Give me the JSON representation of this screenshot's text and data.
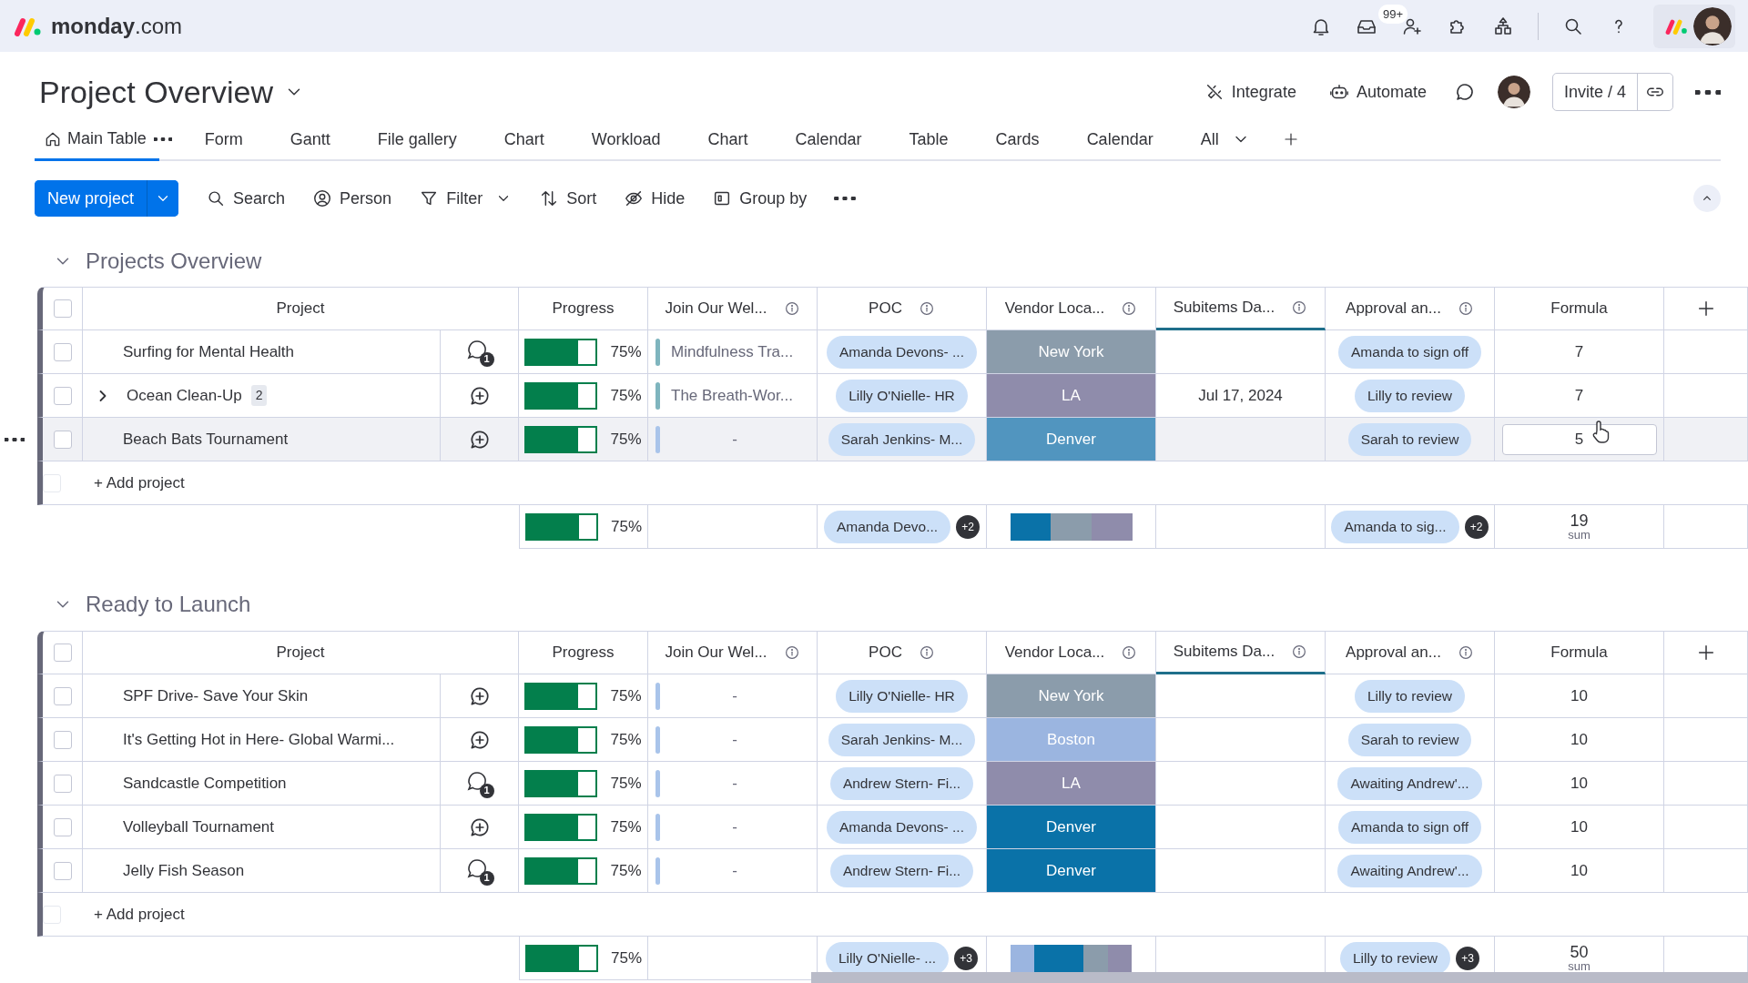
{
  "topbar": {
    "brand": "**monday**.com",
    "inbox_badge": "99+"
  },
  "board": {
    "title": "Project Overview",
    "actions": [
      {
        "label": "Integrate",
        "kind": "integrate"
      },
      {
        "label": "Automate",
        "kind": "automate"
      }
    ],
    "invite": "Invite / 4"
  },
  "views": [
    {
      "label": "Main Table",
      "kind": "main",
      "selected": true
    },
    {
      "label": "Form",
      "kind": "view",
      "selected": false
    },
    {
      "label": "Gantt",
      "kind": "view",
      "selected": false
    },
    {
      "label": "File gallery",
      "kind": "view",
      "selected": false
    },
    {
      "label": "Chart",
      "kind": "view",
      "selected": false
    },
    {
      "label": "Workload",
      "kind": "view",
      "selected": false
    },
    {
      "label": "Chart",
      "kind": "view",
      "selected": false
    },
    {
      "label": "Calendar",
      "kind": "view",
      "selected": false
    },
    {
      "label": "Table",
      "kind": "view",
      "selected": false
    },
    {
      "label": "Cards",
      "kind": "view",
      "selected": false
    },
    {
      "label": "Calendar",
      "kind": "view",
      "selected": false
    }
  ],
  "views_more": "All",
  "toolbar": {
    "primary": "New project",
    "items": [
      {
        "label": "Search",
        "kind": "search"
      },
      {
        "label": "Person",
        "kind": "person"
      },
      {
        "label": "Filter",
        "kind": "filter"
      },
      {
        "label": "Sort",
        "kind": "sort"
      },
      {
        "label": "Hide",
        "kind": "hide"
      },
      {
        "label": "Group by",
        "kind": "group"
      }
    ]
  },
  "groups": [
    {
      "title": "Projects Overview",
      "color": "#676879",
      "header_checked": false,
      "columns": [
        {
          "label": "Project",
          "kind": "name",
          "highlighted": false
        },
        {
          "label": "Progress",
          "kind": "plain",
          "highlighted": false
        },
        {
          "label": "Join Our Wel...",
          "kind": "info",
          "highlighted": false
        },
        {
          "label": "POC",
          "kind": "info",
          "highlighted": false
        },
        {
          "label": "Vendor Loca...",
          "kind": "info",
          "highlighted": false
        },
        {
          "label": "Subitems Da...",
          "kind": "info",
          "highlighted": true
        },
        {
          "label": "Approval an...",
          "kind": "info",
          "highlighted": false
        },
        {
          "label": "Formula",
          "kind": "plain",
          "highlighted": false
        }
      ],
      "rows": [
        {
          "name": "Surfing for Mental Health",
          "checked": false,
          "updates": "1",
          "progress": {
            "level": 0.75,
            "text": "75%"
          },
          "join": {
            "text": "Mindfulness Tra...",
            "color": "#7fb5be"
          },
          "poc": "Amanda Devons- ...",
          "vendor": {
            "text": "New York",
            "color": "#8b9cab"
          },
          "approval": "Amanda to sign off",
          "formula": "7",
          "hovered": false
        },
        {
          "name": "Ocean Clean-Up",
          "checked": false,
          "subitems": {
            "count": "2",
            "expanded": false
          },
          "progress": {
            "level": 0.75,
            "text": "75%"
          },
          "join": {
            "text": "The Breath-Wor...",
            "color": "#7fb5be"
          },
          "poc": "Lilly O'Nielle- HR",
          "vendor": {
            "text": "LA",
            "color": "#8f8cab"
          },
          "date": "Jul 17, 2024",
          "approval": "Lilly to review",
          "formula": "7",
          "hovered": false
        },
        {
          "name": "Beach Bats Tournament",
          "checked": false,
          "progress": {
            "level": 0.75,
            "text": "75%"
          },
          "join": {
            "text": "-",
            "color": "#a9c4ea"
          },
          "poc": "Sarah Jenkins- M...",
          "vendor": {
            "text": "Denver",
            "color": "#5195bf"
          },
          "approval": "Sarah to review",
          "formula": "5",
          "hovered": true
        }
      ],
      "add_row": {
        "label": "+ Add project",
        "checkbox_disabled": true
      },
      "summary": {
        "progress": {
          "level": 0.75,
          "text": "75%"
        },
        "poc": "Amanda Devo...",
        "poc_more": "+2",
        "vendor_segments": [
          {
            "color": "#0a72a8"
          },
          {
            "color": "#8b9cab"
          },
          {
            "color": "#8f8cab"
          }
        ],
        "approval": "Amanda to sig...",
        "approval_more": "+2",
        "formula": "19",
        "formula_label": "sum"
      }
    },
    {
      "title": "Ready to Launch",
      "color": "#676879",
      "header_checked": false,
      "columns": [
        {
          "label": "Project",
          "kind": "name",
          "highlighted": false
        },
        {
          "label": "Progress",
          "kind": "plain",
          "highlighted": false
        },
        {
          "label": "Join Our Wel...",
          "kind": "info",
          "highlighted": false
        },
        {
          "label": "POC",
          "kind": "info",
          "highlighted": false
        },
        {
          "label": "Vendor Loca...",
          "kind": "info",
          "highlighted": false
        },
        {
          "label": "Subitems Da...",
          "kind": "info",
          "highlighted": true
        },
        {
          "label": "Approval an...",
          "kind": "info",
          "highlighted": false
        },
        {
          "label": "Formula",
          "kind": "plain",
          "highlighted": false
        }
      ],
      "rows": [
        {
          "name": "SPF Drive- Save Your Skin",
          "checked": false,
          "progress": {
            "level": 0.75,
            "text": "75%"
          },
          "join": {
            "text": "-",
            "color": "#a9c4ea"
          },
          "poc": "Lilly O'Nielle- HR",
          "vendor": {
            "text": "New York",
            "color": "#8b9cab"
          },
          "approval": "Lilly to review",
          "formula": "10",
          "hovered": false
        },
        {
          "name": "It's Getting Hot in Here- Global Warmi...",
          "checked": false,
          "progress": {
            "level": 0.75,
            "text": "75%"
          },
          "join": {
            "text": "-",
            "color": "#a9c4ea"
          },
          "poc": "Sarah Jenkins- M...",
          "vendor": {
            "text": "Boston",
            "color": "#9bb5e0"
          },
          "approval": "Sarah to review",
          "formula": "10",
          "hovered": false
        },
        {
          "name": "Sandcastle Competition",
          "checked": false,
          "updates": "1",
          "progress": {
            "level": 0.75,
            "text": "75%"
          },
          "join": {
            "text": "-",
            "color": "#a9c4ea"
          },
          "poc": "Andrew Stern- Fi...",
          "vendor": {
            "text": "LA",
            "color": "#8f8cab"
          },
          "approval": "Awaiting Andrew'...",
          "formula": "10",
          "hovered": false
        },
        {
          "name": "Volleyball Tournament",
          "checked": false,
          "progress": {
            "level": 0.75,
            "text": "75%"
          },
          "join": {
            "text": "-",
            "color": "#a9c4ea"
          },
          "poc": "Amanda Devons- ...",
          "vendor": {
            "text": "Denver",
            "color": "#0a72a8"
          },
          "approval": "Amanda to sign off",
          "formula": "10",
          "hovered": false
        },
        {
          "name": "Jelly Fish Season",
          "checked": false,
          "updates": "1",
          "progress": {
            "level": 0.75,
            "text": "75%"
          },
          "join": {
            "text": "-",
            "color": "#a9c4ea"
          },
          "poc": "Andrew Stern- Fi...",
          "vendor": {
            "text": "Denver",
            "color": "#0a72a8"
          },
          "approval": "Awaiting Andrew'...",
          "formula": "10",
          "hovered": false
        }
      ],
      "add_row": {
        "label": "+ Add project",
        "checkbox_disabled": true
      },
      "summary": {
        "progress": {
          "level": 0.75,
          "text": "75%"
        },
        "poc": "Lilly O'Nielle- ...",
        "poc_more": "+3",
        "vendor_segments": [
          {
            "color": "#9bb5e0"
          },
          {
            "color": "#0a72a8"
          },
          {
            "color": "#0a72a8"
          },
          {
            "color": "#8b9cab"
          },
          {
            "color": "#8f8cab"
          }
        ],
        "approval": "Lilly to review",
        "approval_more": "+3",
        "formula": "50",
        "formula_label": "sum"
      }
    }
  ]
}
